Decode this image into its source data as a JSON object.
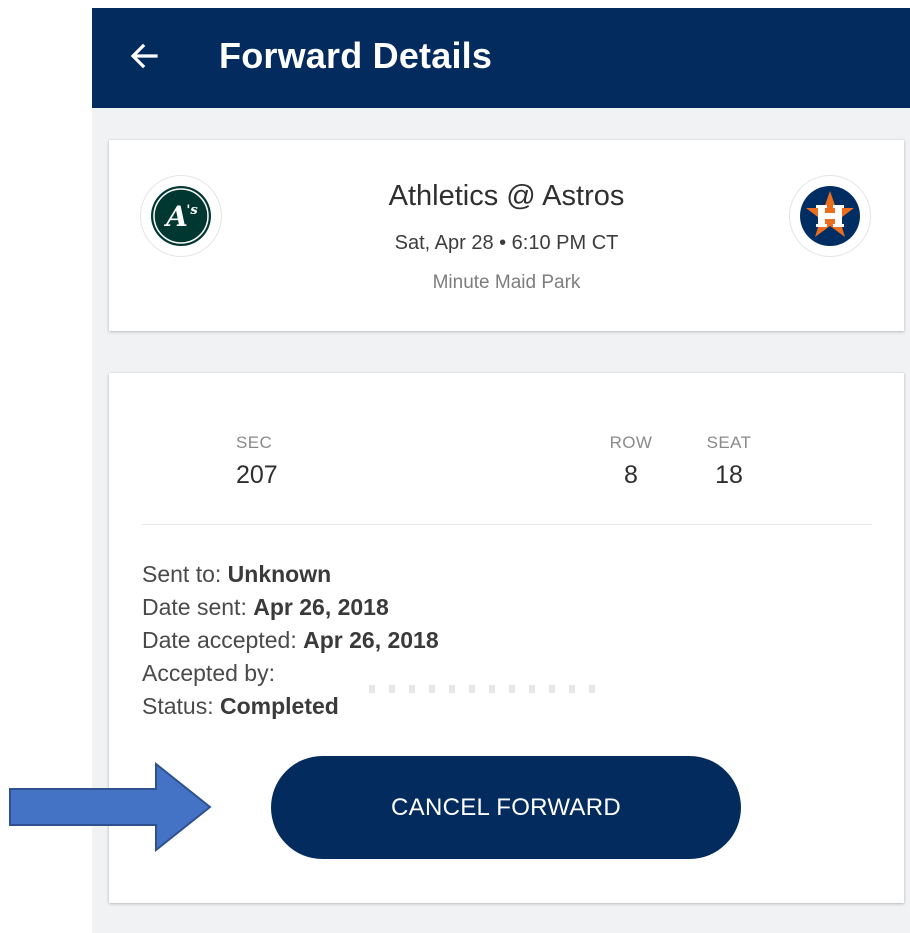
{
  "appbar": {
    "title": "Forward Details",
    "back_icon": "arrow-left-icon"
  },
  "game": {
    "matchup": "Athletics @ Astros",
    "datetime": "Sat, Apr 28 • 6:10 PM CT",
    "venue": "Minute Maid Park",
    "away_logo": {
      "icon": "athletics-logo",
      "text": "A's",
      "color": "#003831"
    },
    "home_logo": {
      "icon": "astros-logo",
      "text": "H",
      "colors": [
        "#002d62",
        "#eb6e1f"
      ]
    }
  },
  "ticket": {
    "sec_label": "SEC",
    "sec_value": "207",
    "row_label": "ROW",
    "row_value": "8",
    "seat_label": "SEAT",
    "seat_value": "18"
  },
  "forward_info": {
    "sent_to_label": "Sent to: ",
    "sent_to_value": "Unknown",
    "date_sent_label": "Date sent: ",
    "date_sent_value": "Apr 26, 2018",
    "date_accepted_label": "Date accepted: ",
    "date_accepted_value": "Apr 26, 2018",
    "accepted_by_label": "Accepted by:",
    "status_label": "Status: ",
    "status_value": "Completed"
  },
  "cancel_button_label": "CANCEL FORWARD",
  "annotation": {
    "icon": "arrow-right-annotation",
    "color": "#4472c4"
  },
  "colors": {
    "primary": "#032b5e",
    "background": "#f1f2f4"
  }
}
